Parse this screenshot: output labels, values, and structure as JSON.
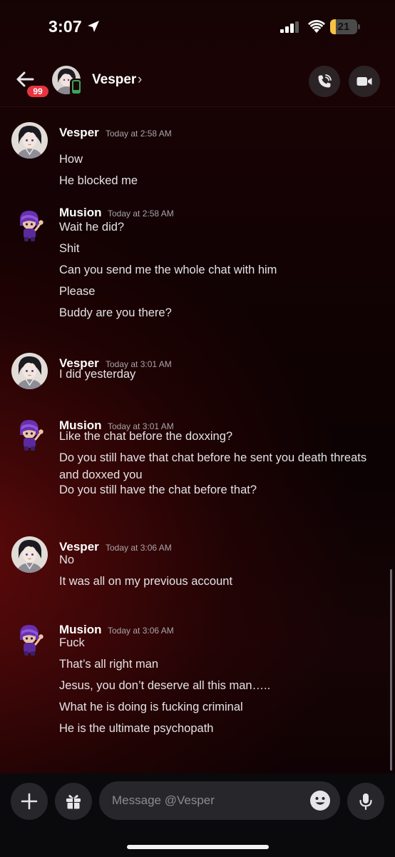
{
  "status_bar": {
    "time": "3:07",
    "battery": "21",
    "battery_level": 0.21
  },
  "header": {
    "back_badge": "99",
    "contact_name": "Vesper",
    "chevron": "›"
  },
  "messages": [
    {
      "author": "Vesper",
      "timestamp": "Today at 2:58 AM",
      "lines": [
        "How",
        "He blocked me"
      ]
    },
    {
      "author": "Musion",
      "timestamp": "Today at 2:58 AM",
      "lines": [
        "Wait he did?",
        "Shit",
        "Can you send me the whole chat with him",
        "Please",
        "Buddy are you there?"
      ]
    },
    {
      "author": "Vesper",
      "timestamp": "Today at 3:01 AM",
      "lines": [
        "I did yesterday"
      ]
    },
    {
      "author": "Musion",
      "timestamp": "Today at 3:01 AM",
      "lines": [
        "Like the chat before the doxxing?",
        "Do you still have that chat before he sent you death threats and doxxed you",
        "Do you still have the chat before that?"
      ]
    },
    {
      "author": "Vesper",
      "timestamp": "Today at 3:06 AM",
      "lines": [
        "No",
        "It was all on my previous account"
      ]
    },
    {
      "author": "Musion",
      "timestamp": "Today at 3:06 AM",
      "lines": [
        "Fuck",
        "That’s all right man",
        "Jesus, you don’t deserve all this man…..",
        "What he is doing is fucking criminal",
        "He is the ultimate psychopath"
      ]
    }
  ],
  "composer": {
    "placeholder": "Message @Vesper"
  },
  "icons": {
    "status": [
      "location-arrow-icon",
      "signal-icon",
      "wifi-icon",
      "battery-icon"
    ],
    "header": [
      "back-arrow-icon",
      "phone-icon",
      "video-camera-icon"
    ],
    "composer": [
      "plus-icon",
      "gift-icon",
      "emoji-icon",
      "microphone-icon"
    ]
  },
  "colors": {
    "badge": "#e8343f",
    "online_mobile": "#3ba55c",
    "musion_avatar": "#6a2fb3",
    "background_accent": "#780c0c"
  }
}
